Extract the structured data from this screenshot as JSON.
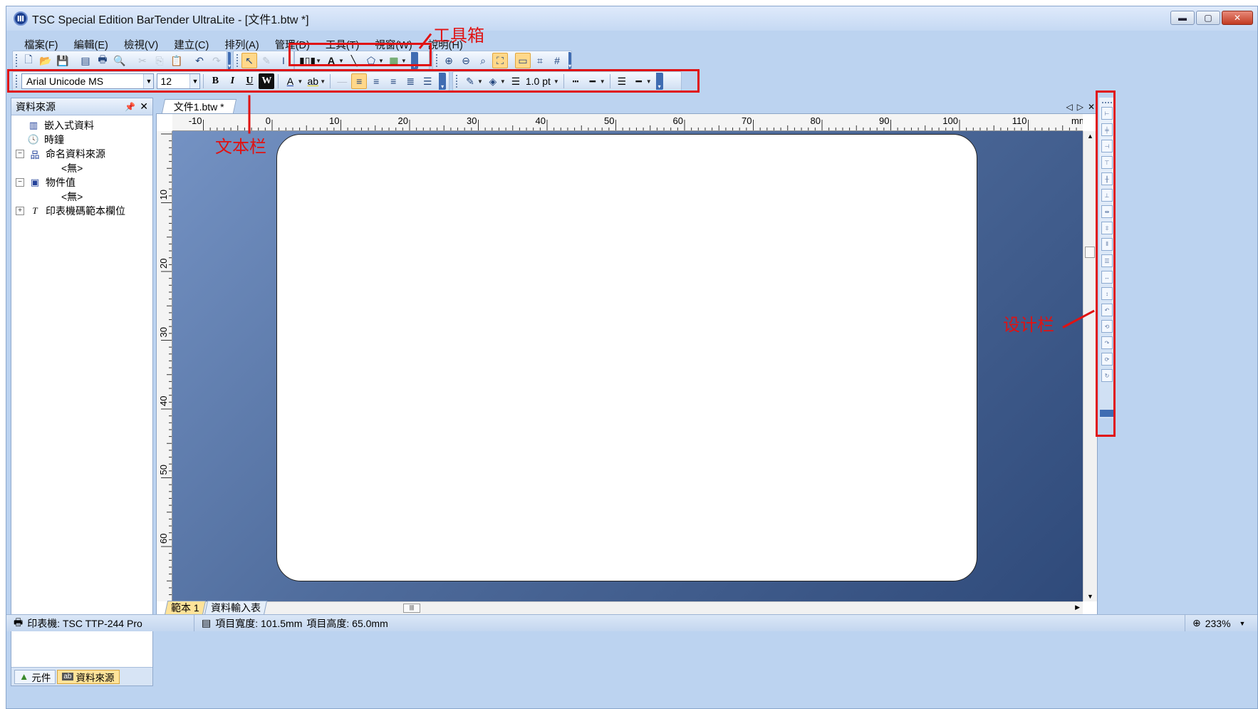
{
  "window": {
    "title": "TSC Special Edition BarTender UltraLite - [文件1.btw *]"
  },
  "menu": [
    "檔案(F)",
    "編輯(E)",
    "檢視(V)",
    "建立(C)",
    "排列(A)",
    "管理(D)",
    "工具(T)",
    "視窗(W)",
    "說明(H)"
  ],
  "text_toolbar": {
    "font": "Arial Unicode MS",
    "size": "12",
    "line_width": "1.0 pt",
    "bold": "B",
    "italic": "I",
    "underline": "U",
    "word": "W"
  },
  "left_panel": {
    "title": "資料來源",
    "tree": [
      {
        "label": "嵌入式資料"
      },
      {
        "label": "時鐘"
      },
      {
        "label": "命名資料來源"
      },
      {
        "label": "<無>"
      },
      {
        "label": "物件值"
      },
      {
        "label": "<無>"
      },
      {
        "label": "印表機碼範本欄位"
      }
    ],
    "tabs": [
      "元件",
      "資料來源"
    ]
  },
  "document": {
    "tab": "文件1.btw *",
    "ruler_h": [
      "-10",
      "0",
      "10",
      "20",
      "30",
      "40",
      "50",
      "60",
      "70",
      "80",
      "90",
      "100",
      "110"
    ],
    "ruler_unit": "mm",
    "ruler_v": [
      "10",
      "20",
      "30",
      "40",
      "50",
      "60"
    ],
    "sheet_tabs": [
      "範本 1",
      "資料輸入表"
    ]
  },
  "status": {
    "printer": "印表機: TSC TTP-244 Pro",
    "item_width": "項目寬度: 101.5mm",
    "item_height": "項目高度: 65.0mm",
    "zoom": "233%"
  },
  "annotations": {
    "toolbox": "工具箱",
    "textbar": "文本栏",
    "designbar": "设计栏"
  },
  "colors": {
    "annotation": "#e01212",
    "canvas": "#4f6c9c"
  }
}
